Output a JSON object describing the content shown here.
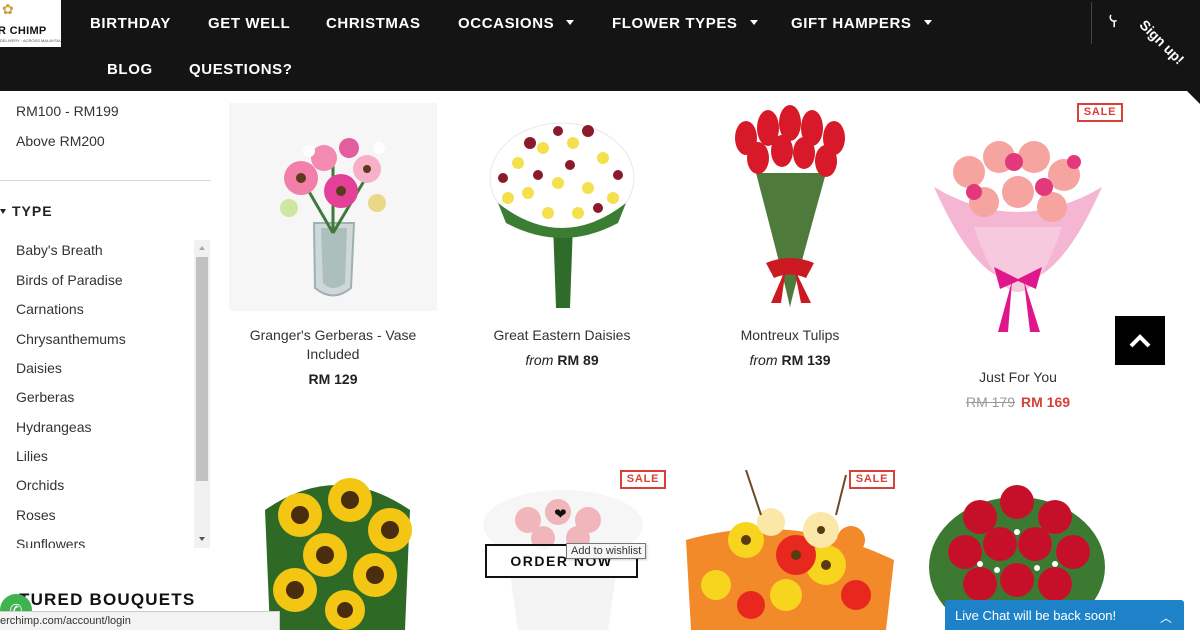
{
  "logo": {
    "mark": "✿",
    "brand": "R CHIMP",
    "tagline": "DELIVERY · ACROSS MALAYSIA"
  },
  "nav": {
    "items": [
      {
        "label": "BIRTHDAY"
      },
      {
        "label": "GET WELL"
      },
      {
        "label": "CHRISTMAS"
      },
      {
        "label": "OCCASIONS"
      },
      {
        "label": "FLOWER TYPES"
      },
      {
        "label": "GIFT HAMPERS"
      },
      {
        "label": "BLOG"
      },
      {
        "label": "QUESTIONS?"
      }
    ],
    "signup_label": "Sign up!"
  },
  "sidebar": {
    "price_filters": [
      "RM100 - RM199",
      "Above RM200"
    ],
    "type_heading": "TYPE",
    "types": [
      "Baby's Breath",
      "Birds of Paradise",
      "Carnations",
      "Chrysanthemums",
      "Daisies",
      "Gerberas",
      "Hydrangeas",
      "Lilies",
      "Orchids",
      "Roses",
      "Sunflowers"
    ],
    "featured_heading": "TURED BOUQUETS"
  },
  "products": [
    {
      "name": "Granger's Gerberas - Vase Included",
      "price": "RM 129"
    },
    {
      "name": "Great Eastern Daisies",
      "from": "from",
      "price": "RM 89"
    },
    {
      "name": "Montreux Tulips",
      "from": "from",
      "price": "RM 139"
    },
    {
      "name": "Just For You",
      "old_price": "RM 179",
      "price": "RM 169",
      "badge": "SALE"
    }
  ],
  "row2": {
    "badges": [
      "SALE",
      "SALE"
    ]
  },
  "order_now_label": "ORDER NOW",
  "wishlist_tooltip": "Add to wishlist",
  "status_url": "erchimp.com/account/login",
  "live_chat": "Live Chat will be back soon!",
  "colors": {
    "nav_bg": "#141414",
    "sale_red": "#d8403a",
    "chat_blue": "#1e82c8"
  }
}
